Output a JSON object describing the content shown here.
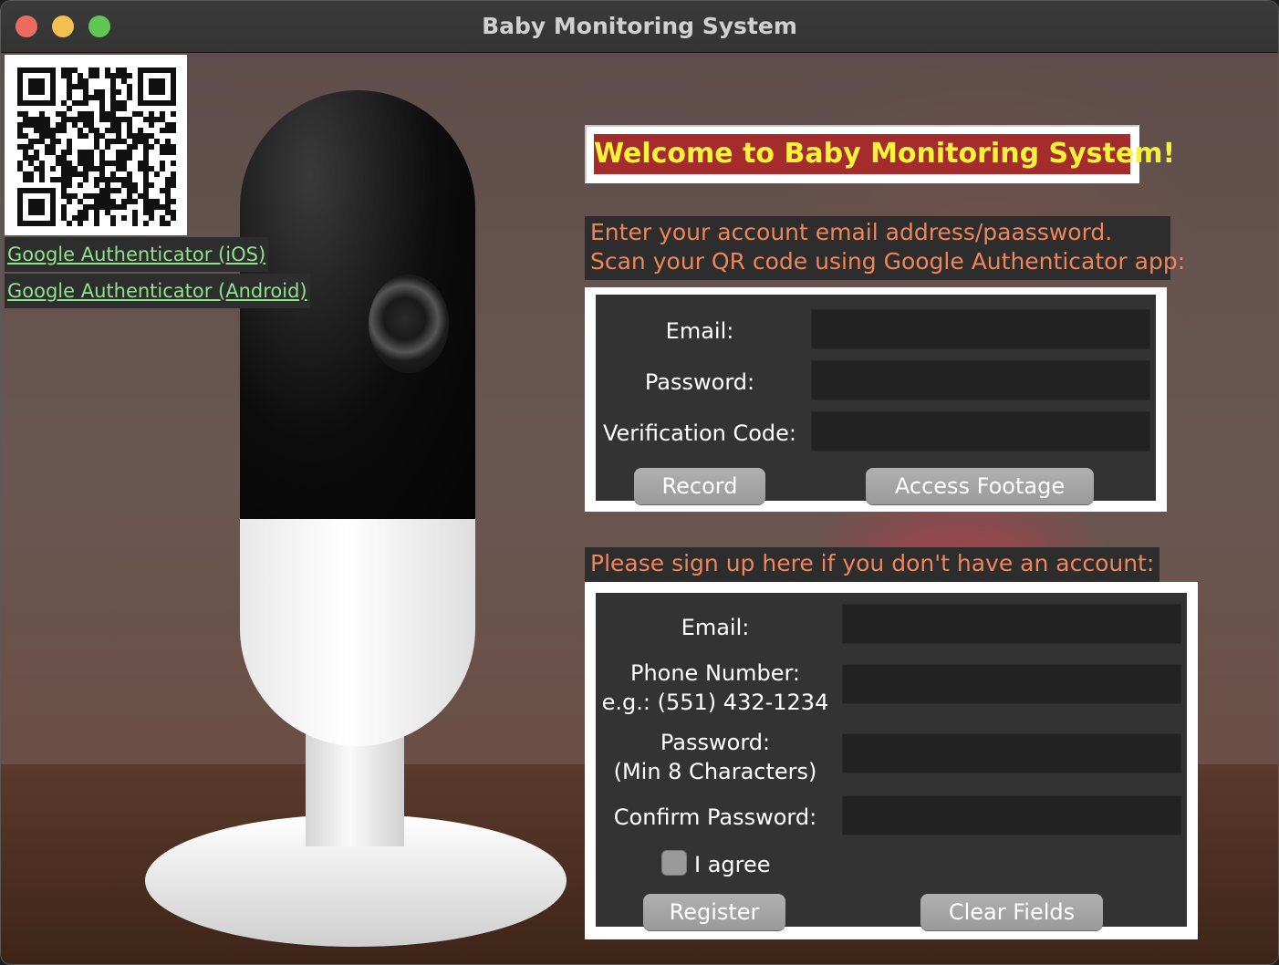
{
  "window": {
    "title": "Baby Monitoring System"
  },
  "links": {
    "ios": "Google Authenticator (iOS)",
    "android": "Google Authenticator (Android)"
  },
  "banner": {
    "text": "Welcome to Baby Monitoring System!"
  },
  "login": {
    "note_line1": "Enter your account email address/paassword.",
    "note_line2": "Scan your QR code using Google Authenticator app:",
    "email_label": "Email:",
    "password_label": "Password:",
    "code_label": "Verification Code:",
    "email_value": "",
    "password_value": "",
    "code_value": "",
    "record_button": "Record",
    "access_button": "Access Footage"
  },
  "signup": {
    "note": "Please sign up here if you don't have an account:",
    "email_label": "Email:",
    "phone_label_line1": "Phone Number:",
    "phone_label_line2": "e.g.: (551) 432-1234",
    "password_label_line1": "Password:",
    "password_label_line2": "(Min 8 Characters)",
    "confirm_label": "Confirm Password:",
    "agree_label": "I agree",
    "agree_checked": false,
    "register_button": "Register",
    "clear_button": "Clear Fields"
  },
  "colors": {
    "banner_bg": "#a42c2c",
    "banner_text": "#f8f23a",
    "note_text": "#f0855a",
    "link_text": "#8ee38a"
  }
}
